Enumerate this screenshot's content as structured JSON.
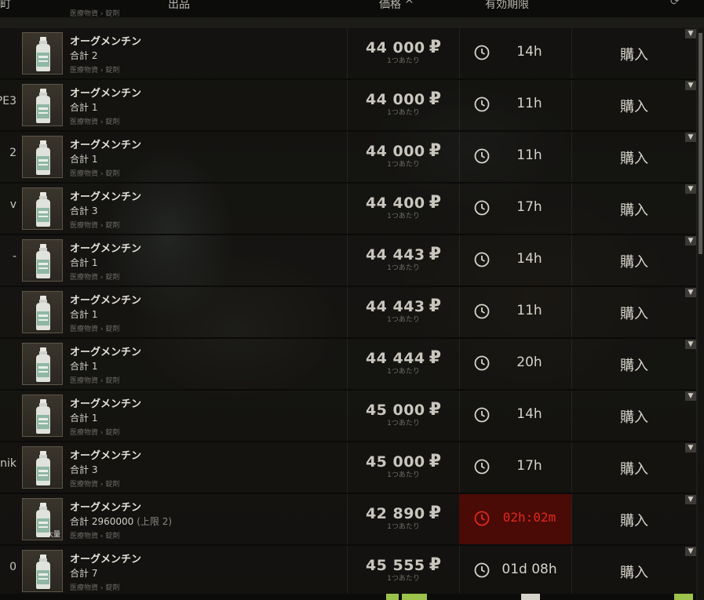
{
  "header": {
    "col_left": "町",
    "col_offer": "出品",
    "col_price": "価格 ^",
    "col_expiry": "有効期限"
  },
  "top_partial": {
    "category": "医療物資 › 錠剤"
  },
  "rows": [
    {
      "seller": "",
      "name": "オーグメンチン",
      "qty": "合計 2",
      "limit": "",
      "category": "医療物資 › 錠剤",
      "price": "44 000",
      "per": "1つあたり",
      "expires": "14h",
      "urgent": false,
      "bulk": "",
      "buy": "購入"
    },
    {
      "seller": "PE3",
      "name": "オーグメンチン",
      "qty": "合計 1",
      "limit": "",
      "category": "医療物資 › 錠剤",
      "price": "44 000",
      "per": "1つあたり",
      "expires": "11h",
      "urgent": false,
      "bulk": "",
      "buy": "購入"
    },
    {
      "seller": "2",
      "name": "オーグメンチン",
      "qty": "合計 1",
      "limit": "",
      "category": "医療物資 › 錠剤",
      "price": "44 000",
      "per": "1つあたり",
      "expires": "11h",
      "urgent": false,
      "bulk": "",
      "buy": "購入"
    },
    {
      "seller": "v",
      "name": "オーグメンチン",
      "qty": "合計 3",
      "limit": "",
      "category": "医療物資 › 錠剤",
      "price": "44 400",
      "per": "1つあたり",
      "expires": "17h",
      "urgent": false,
      "bulk": "",
      "buy": "購入"
    },
    {
      "seller": "-",
      "name": "オーグメンチン",
      "qty": "合計 1",
      "limit": "",
      "category": "医療物資 › 錠剤",
      "price": "44 443",
      "per": "1つあたり",
      "expires": "14h",
      "urgent": false,
      "bulk": "",
      "buy": "購入"
    },
    {
      "seller": "",
      "name": "オーグメンチン",
      "qty": "合計 1",
      "limit": "",
      "category": "医療物資 › 錠剤",
      "price": "44 443",
      "per": "1つあたり",
      "expires": "11h",
      "urgent": false,
      "bulk": "",
      "buy": "購入"
    },
    {
      "seller": "",
      "name": "オーグメンチン",
      "qty": "合計 1",
      "limit": "",
      "category": "医療物資 › 錠剤",
      "price": "44 444",
      "per": "1つあたり",
      "expires": "20h",
      "urgent": false,
      "bulk": "",
      "buy": "購入"
    },
    {
      "seller": "",
      "name": "オーグメンチン",
      "qty": "合計 1",
      "limit": "",
      "category": "医療物資 › 錠剤",
      "price": "45 000",
      "per": "1つあたり",
      "expires": "14h",
      "urgent": false,
      "bulk": "",
      "buy": "購入"
    },
    {
      "seller": "nik",
      "name": "オーグメンチン",
      "qty": "合計 3",
      "limit": "",
      "category": "医療物資 › 錠剤",
      "price": "45 000",
      "per": "1つあたり",
      "expires": "17h",
      "urgent": false,
      "bulk": "",
      "buy": "購入"
    },
    {
      "seller": "",
      "name": "オーグメンチン",
      "qty": "合計 2960000",
      "limit": "(上限 2)",
      "category": "医療物資 › 錠剤",
      "price": "42 890",
      "per": "1つあたり",
      "expires": "02h:02m",
      "urgent": true,
      "bulk": "大量",
      "buy": "購入"
    },
    {
      "seller": "0",
      "name": "オーグメンチン",
      "qty": "合計 7",
      "limit": "",
      "category": "医療物資 › 錠剤",
      "price": "45 555",
      "per": "1つあたり",
      "expires": "01d 08h",
      "urgent": false,
      "bulk": "",
      "buy": "購入"
    }
  ],
  "currency_symbol": "₽",
  "colors": {
    "urgent_bg": "#4a0a06",
    "urgent_text": "#e02a1c",
    "accent_green": "#9bc24a"
  },
  "icons": {
    "clock": "clock-icon",
    "dropdown": "chevron-down-icon",
    "refresh": "refresh-icon",
    "item": "pill-bottle-icon"
  }
}
